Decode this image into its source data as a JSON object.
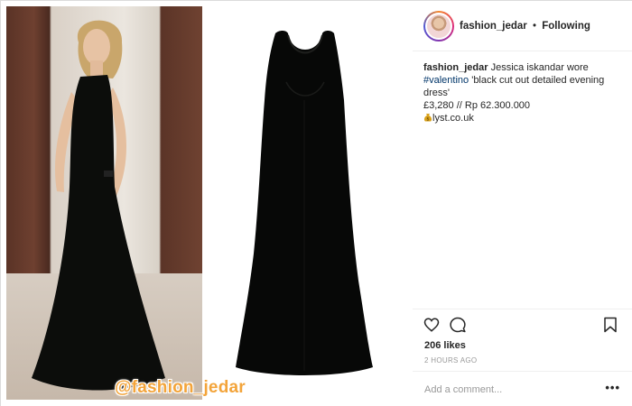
{
  "post": {
    "username": "fashion_jedar",
    "separator": "•",
    "follow_status": "Following",
    "caption": {
      "username": "fashion_jedar",
      "text_before_tag": " Jessica iskandar wore ",
      "hashtag": "#valentino",
      "text_after_tag": " 'black cut out detailed evening dress'",
      "price_line": "£3,280 // Rp 62.300.000",
      "source_icon": "money-bag-icon",
      "source_line": "lyst.co.uk"
    },
    "likes": "206 likes",
    "timestamp": "2 HOURS AGO",
    "comment_placeholder": "Add a comment...",
    "more_label": "•••",
    "watermark": "@fashion_jedar"
  },
  "icons": {
    "like": "heart-icon",
    "comment": "comment-icon",
    "save": "bookmark-icon"
  },
  "colors": {
    "text": "#262626",
    "muted": "#999999",
    "link": "#003569",
    "border": "#efefef",
    "watermark": "#f3a43a"
  }
}
